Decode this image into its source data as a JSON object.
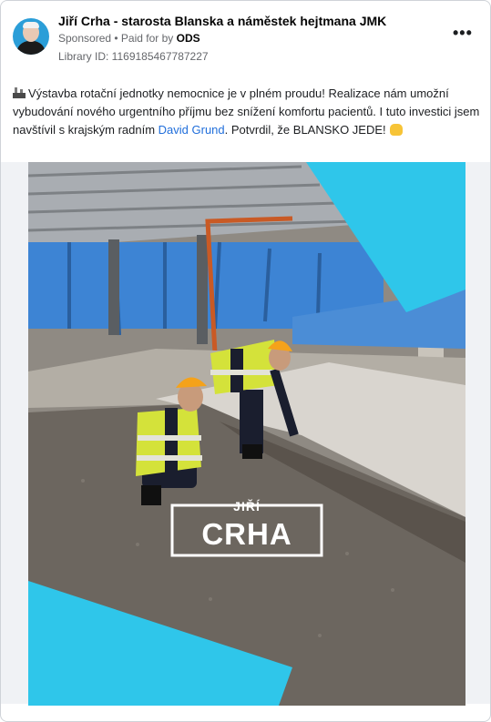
{
  "header": {
    "page_name": "Jiří Crha - starosta Blanska a náměstek hejtmana JMK",
    "sponsored": "Sponsored",
    "paid_for_prefix": " • Paid for by ",
    "paid_for_by": "ODS",
    "library_id": "Library ID: 1169185467787227",
    "more_glyph": "•••"
  },
  "post": {
    "text_1": "Výstavba rotační jednotky nemocnice je v plném proudu! Realizace nám umožní vybudování nového urgentního příjmu bez snížení komfortu pacientů. I tuto investici jsem navštívil s krajským radním ",
    "mention": "David Grund",
    "text_2": ". Potvrdil, že BLANSKO JEDE!",
    "icons": [
      "construction-emoji",
      "raised-hands-emoji"
    ]
  },
  "image": {
    "logo_first_name": "JIŘÍ",
    "logo_last_name": "CRHA"
  },
  "colors": {
    "accent_cyan": "#2fc6ea",
    "link_blue": "#216fdb",
    "vest_yellow": "#d4e23a",
    "helmet_orange": "#f5a21a"
  }
}
